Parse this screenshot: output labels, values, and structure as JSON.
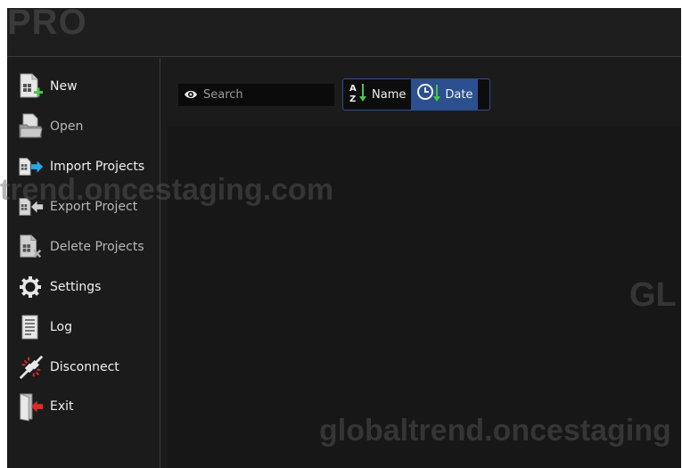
{
  "app": {
    "brand": "PRO"
  },
  "sidebar": {
    "items": [
      {
        "label": "New",
        "icon": "new-project-icon"
      },
      {
        "label": "Open",
        "icon": "open-folder-icon"
      },
      {
        "label": "Import Projects",
        "icon": "import-icon"
      },
      {
        "label": "Export Project",
        "icon": "export-icon"
      },
      {
        "label": "Delete Projects",
        "icon": "delete-icon"
      },
      {
        "label": "Settings",
        "icon": "gear-icon"
      },
      {
        "label": "Log",
        "icon": "log-icon"
      },
      {
        "label": "Disconnect",
        "icon": "disconnect-icon"
      },
      {
        "label": "Exit",
        "icon": "exit-door-icon"
      }
    ]
  },
  "toolbar": {
    "search_placeholder": "Search",
    "sort_name_label": "Name",
    "sort_date_label": "Date",
    "active_sort": "Date"
  },
  "watermarks": {
    "text_1": "trend.oncestaging.com",
    "text_2": "globaltrend.oncestaging",
    "text_3": "GL"
  },
  "colors": {
    "accent": "#2b4f8f",
    "background": "#1b1b1b",
    "import_arrow": "#2aa8e8",
    "exit_arrow": "#e02a2a",
    "new_plus": "#4fc24f"
  }
}
